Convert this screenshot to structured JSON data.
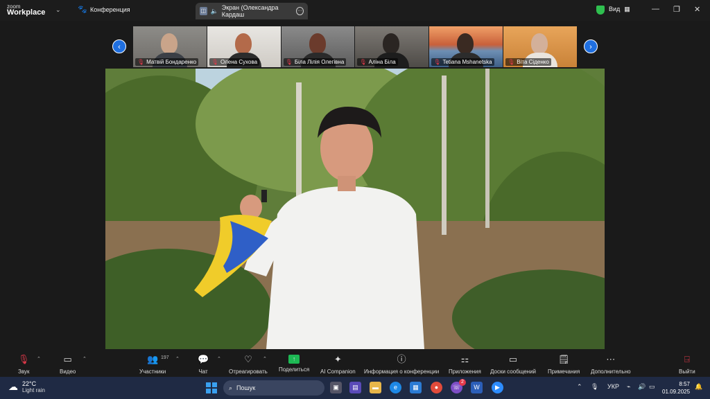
{
  "titlebar": {
    "logo_line1": "zoom",
    "logo_line2": "Workplace",
    "meeting_label": "Конференция",
    "share_tab_label": "Экран (Олександра Кардаш",
    "view_label": "Вид",
    "status_color": "#2fbf4f"
  },
  "gallery": {
    "participants": [
      {
        "name": "Матвій Бондаренко"
      },
      {
        "name": "Олена Сухова"
      },
      {
        "name": "Біла Лілія Олегівна"
      },
      {
        "name": "Аліна Біла"
      },
      {
        "name": "Tetiana Mshanetska"
      },
      {
        "name": "Віта Сіденко"
      }
    ]
  },
  "toolbar": {
    "audio_label": "Звук",
    "video_label": "Видео",
    "participants_label": "Участники",
    "participants_count": "197",
    "chat_label": "Чат",
    "react_label": "Отреагировать",
    "share_label": "Поделиться",
    "companion_label": "AI Companion",
    "info_label": "Информация о конференции",
    "apps_label": "Приложения",
    "whiteboards_label": "Доски сообщений",
    "notes_label": "Примечания",
    "more_label": "Дополнительно",
    "leave_label": "Выйти",
    "share_color": "#1db954",
    "leave_color": "#e5394a"
  },
  "taskbar": {
    "temperature": "22°C",
    "weather": "Light rain",
    "search_placeholder": "Пошук",
    "language": "УКР",
    "time": "8:57",
    "date": "01.09.2025",
    "viber_badge": "2"
  }
}
